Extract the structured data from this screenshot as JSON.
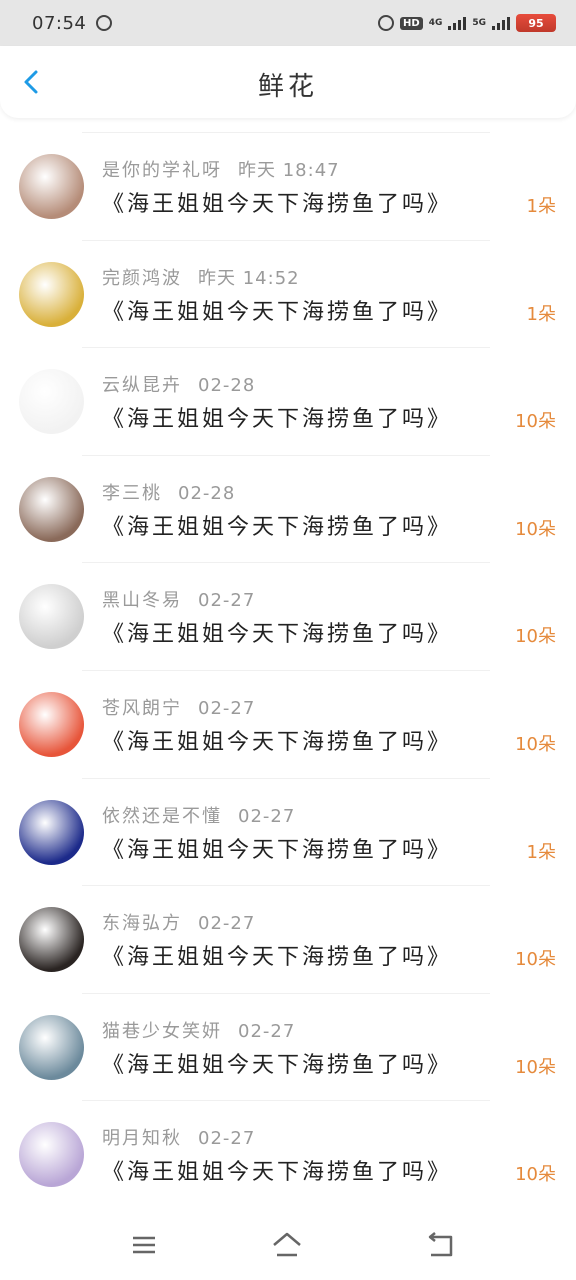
{
  "status_bar": {
    "time": "07:54",
    "network_4g": "4G",
    "network_5g": "5G",
    "hd_label": "HD",
    "battery": "95"
  },
  "header": {
    "title": "鲜花"
  },
  "items": [
    {
      "name": "是你的学礼呀",
      "date": "昨天 18:47",
      "title": "《海王姐姐今天下海捞鱼了吗》",
      "count": "1朵",
      "avatar_color": "#b58c78"
    },
    {
      "name": "完颜鸿波",
      "date": "昨天 14:52",
      "title": "《海王姐姐今天下海捞鱼了吗》",
      "count": "1朵",
      "avatar_color": "#d9b03a"
    },
    {
      "name": "云纵昆卉",
      "date": "02-28",
      "title": "《海王姐姐今天下海捞鱼了吗》",
      "count": "10朵",
      "avatar_color": "#f2f2f2"
    },
    {
      "name": "李三桃",
      "date": "02-28",
      "title": "《海王姐姐今天下海捞鱼了吗》",
      "count": "10朵",
      "avatar_color": "#8a6a5a"
    },
    {
      "name": "黑山冬易",
      "date": "02-27",
      "title": "《海王姐姐今天下海捞鱼了吗》",
      "count": "10朵",
      "avatar_color": "#cfcfcf"
    },
    {
      "name": "苍风朗宁",
      "date": "02-27",
      "title": "《海王姐姐今天下海捞鱼了吗》",
      "count": "10朵",
      "avatar_color": "#e7553a"
    },
    {
      "name": "依然还是不懂",
      "date": "02-27",
      "title": "《海王姐姐今天下海捞鱼了吗》",
      "count": "1朵",
      "avatar_color": "#1c2a8a"
    },
    {
      "name": "东海弘方",
      "date": "02-27",
      "title": "《海王姐姐今天下海捞鱼了吗》",
      "count": "10朵",
      "avatar_color": "#2a2422"
    },
    {
      "name": "猫巷少女笑妍",
      "date": "02-27",
      "title": "《海王姐姐今天下海捞鱼了吗》",
      "count": "10朵",
      "avatar_color": "#6c8a9c"
    },
    {
      "name": "明月知秋",
      "date": "02-27",
      "title": "《海王姐姐今天下海捞鱼了吗》",
      "count": "10朵",
      "avatar_color": "#b9a6d6"
    }
  ],
  "colors": {
    "accent": "#1e9be6",
    "count": "#e58a3c",
    "meta": "#9a9a9a"
  }
}
